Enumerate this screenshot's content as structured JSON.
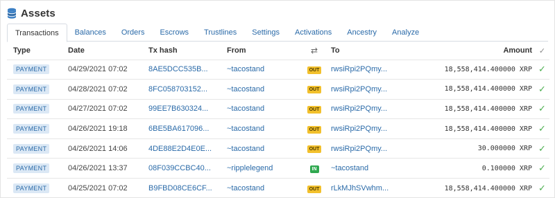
{
  "header": {
    "title": "Assets",
    "icon": "database-icon"
  },
  "tabs": [
    {
      "label": "Transactions",
      "active": true
    },
    {
      "label": "Balances",
      "active": false
    },
    {
      "label": "Orders",
      "active": false
    },
    {
      "label": "Escrows",
      "active": false
    },
    {
      "label": "Trustlines",
      "active": false
    },
    {
      "label": "Settings",
      "active": false
    },
    {
      "label": "Activations",
      "active": false
    },
    {
      "label": "Ancestry",
      "active": false
    },
    {
      "label": "Analyze",
      "active": false
    }
  ],
  "table": {
    "columns": {
      "type": "Type",
      "date": "Date",
      "hash": "Tx hash",
      "from": "From",
      "swap": "⇄",
      "to": "To",
      "amount": "Amount",
      "check": "✓"
    },
    "rows": [
      {
        "type": "PAYMENT",
        "date": "04/29/2021 07:02",
        "hash": "8AE5DCC535B...",
        "from": "~tacostand",
        "dir": "OUT",
        "to": "rwsiRpi2PQmy...",
        "amount": "18,558,414.400000 XRP",
        "check": "✓"
      },
      {
        "type": "PAYMENT",
        "date": "04/28/2021 07:02",
        "hash": "8FC058703152...",
        "from": "~tacostand",
        "dir": "OUT",
        "to": "rwsiRpi2PQmy...",
        "amount": "18,558,414.400000 XRP",
        "check": "✓"
      },
      {
        "type": "PAYMENT",
        "date": "04/27/2021 07:02",
        "hash": "99EE7B630324...",
        "from": "~tacostand",
        "dir": "OUT",
        "to": "rwsiRpi2PQmy...",
        "amount": "18,558,414.400000 XRP",
        "check": "✓"
      },
      {
        "type": "PAYMENT",
        "date": "04/26/2021 19:18",
        "hash": "6BE5BA617096...",
        "from": "~tacostand",
        "dir": "OUT",
        "to": "rwsiRpi2PQmy...",
        "amount": "18,558,414.400000 XRP",
        "check": "✓"
      },
      {
        "type": "PAYMENT",
        "date": "04/26/2021 14:06",
        "hash": "4DE88E2D4E0E...",
        "from": "~tacostand",
        "dir": "OUT",
        "to": "rwsiRpi2PQmy...",
        "amount": "30.000000 XRP",
        "check": "✓"
      },
      {
        "type": "PAYMENT",
        "date": "04/26/2021 13:37",
        "hash": "08F039CCBC40...",
        "from": "~ripplelegend",
        "dir": "IN",
        "to": "~tacostand",
        "amount": "0.100000 XRP",
        "check": "✓"
      },
      {
        "type": "PAYMENT",
        "date": "04/25/2021 07:02",
        "hash": "B9FBD08CE6CF...",
        "from": "~tacostand",
        "dir": "OUT",
        "to": "rLkMJhSVwhm...",
        "amount": "18,558,414.400000 XRP",
        "check": "✓"
      }
    ]
  },
  "colors": {
    "link": "#2a6aa8",
    "out_badge": "#f2c02c",
    "in_badge": "#2fa84f",
    "check": "#4caf50",
    "type_badge_bg": "#dbe8f5"
  }
}
